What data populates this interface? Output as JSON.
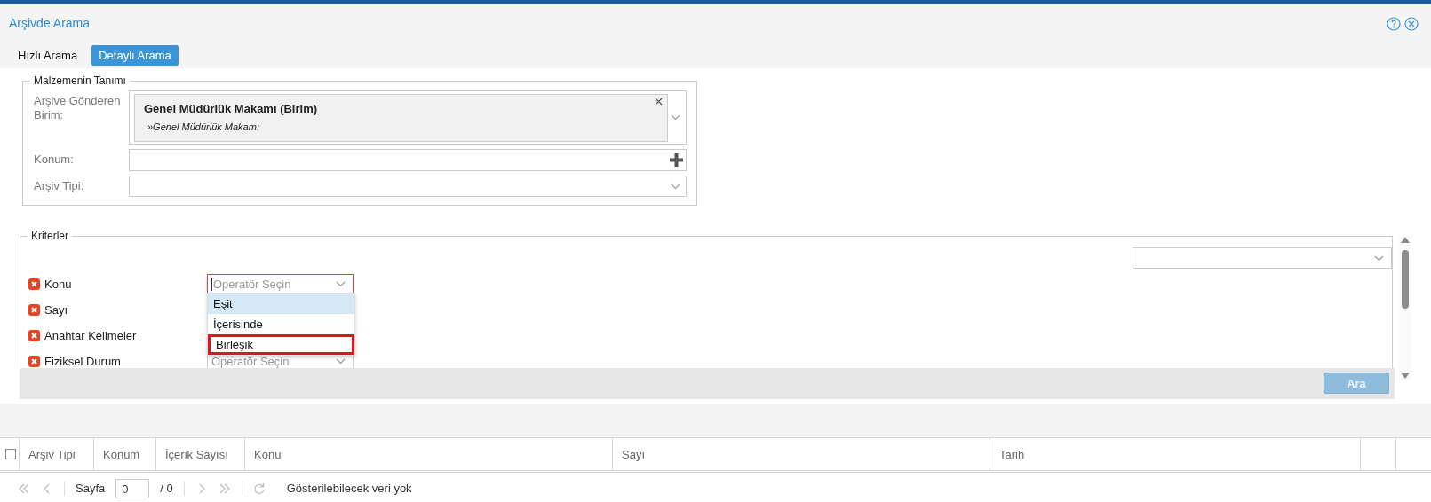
{
  "window": {
    "title": "Arşivde Arama"
  },
  "tabs": [
    {
      "label": "Hızlı Arama",
      "selected": false
    },
    {
      "label": "Detaylı Arama",
      "selected": true
    }
  ],
  "material": {
    "legend": "Malzemenin Tanımı",
    "fields": [
      {
        "kind": "chip-select",
        "label": "Arşive Gönderen Birim:",
        "chip": {
          "title": "Genel Müdürlük Makamı (Birim)",
          "path": "»Genel Müdürlük Makamı"
        }
      },
      {
        "kind": "add",
        "label": "Konum:"
      },
      {
        "kind": "select",
        "label": "Arşiv Tipi:"
      }
    ]
  },
  "criteria": {
    "legend": "Kriterler",
    "rows": [
      {
        "label": "Konu",
        "operator": {
          "placeholder": "Operatör Seçin",
          "focused": true,
          "expanded": true,
          "options": [
            {
              "label": "Eşit",
              "selected": true,
              "highlighted": false
            },
            {
              "label": "İçerisinde",
              "selected": false,
              "highlighted": false
            },
            {
              "label": "Birleşik",
              "selected": false,
              "highlighted": true
            }
          ]
        }
      },
      {
        "label": "Sayı"
      },
      {
        "label": "Anahtar Kelimeler"
      },
      {
        "label": "Fiziksel Durum",
        "operator": {
          "placeholder": "Operatör Seçin",
          "focused": false,
          "expanded": false
        }
      }
    ]
  },
  "search_button": {
    "label": "Ara",
    "disabled": true
  },
  "table": {
    "columns": [
      "Arşiv Tipi",
      "Konum",
      "İçerik Sayısı",
      "Konu",
      "Sayı",
      "Tarih"
    ],
    "all_checked": false
  },
  "pager": {
    "page_label": "Sayfa",
    "page": "0",
    "total": "/ 0",
    "message": "Gösterilebilecek veri yok"
  }
}
